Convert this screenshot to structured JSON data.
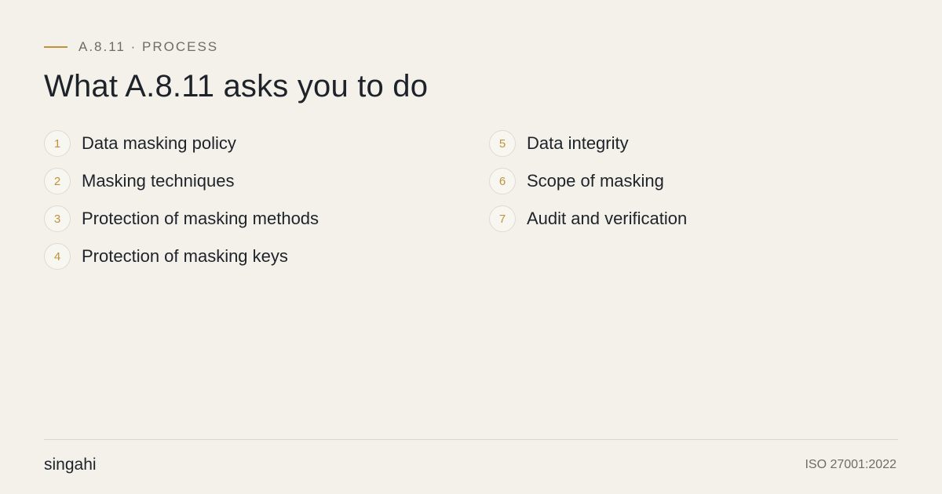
{
  "header": {
    "eyebrow": "A.8.11 · PROCESS",
    "title": "What A.8.11 asks you to do"
  },
  "steps_left": [
    {
      "number": "1",
      "label": "Data masking policy"
    },
    {
      "number": "2",
      "label": "Masking techniques"
    },
    {
      "number": "3",
      "label": "Protection of masking methods"
    },
    {
      "number": "4",
      "label": "Protection of masking keys"
    }
  ],
  "steps_right": [
    {
      "number": "5",
      "label": "Data integrity"
    },
    {
      "number": "6",
      "label": "Scope of masking"
    },
    {
      "number": "7",
      "label": "Audit and verification"
    }
  ],
  "footer": {
    "brand": "singahi",
    "standard": "ISO 27001:2022"
  },
  "colors": {
    "background": "#f4f1eb",
    "accent": "#c0923a",
    "text": "#1d2329",
    "muted": "#6f6c67"
  }
}
